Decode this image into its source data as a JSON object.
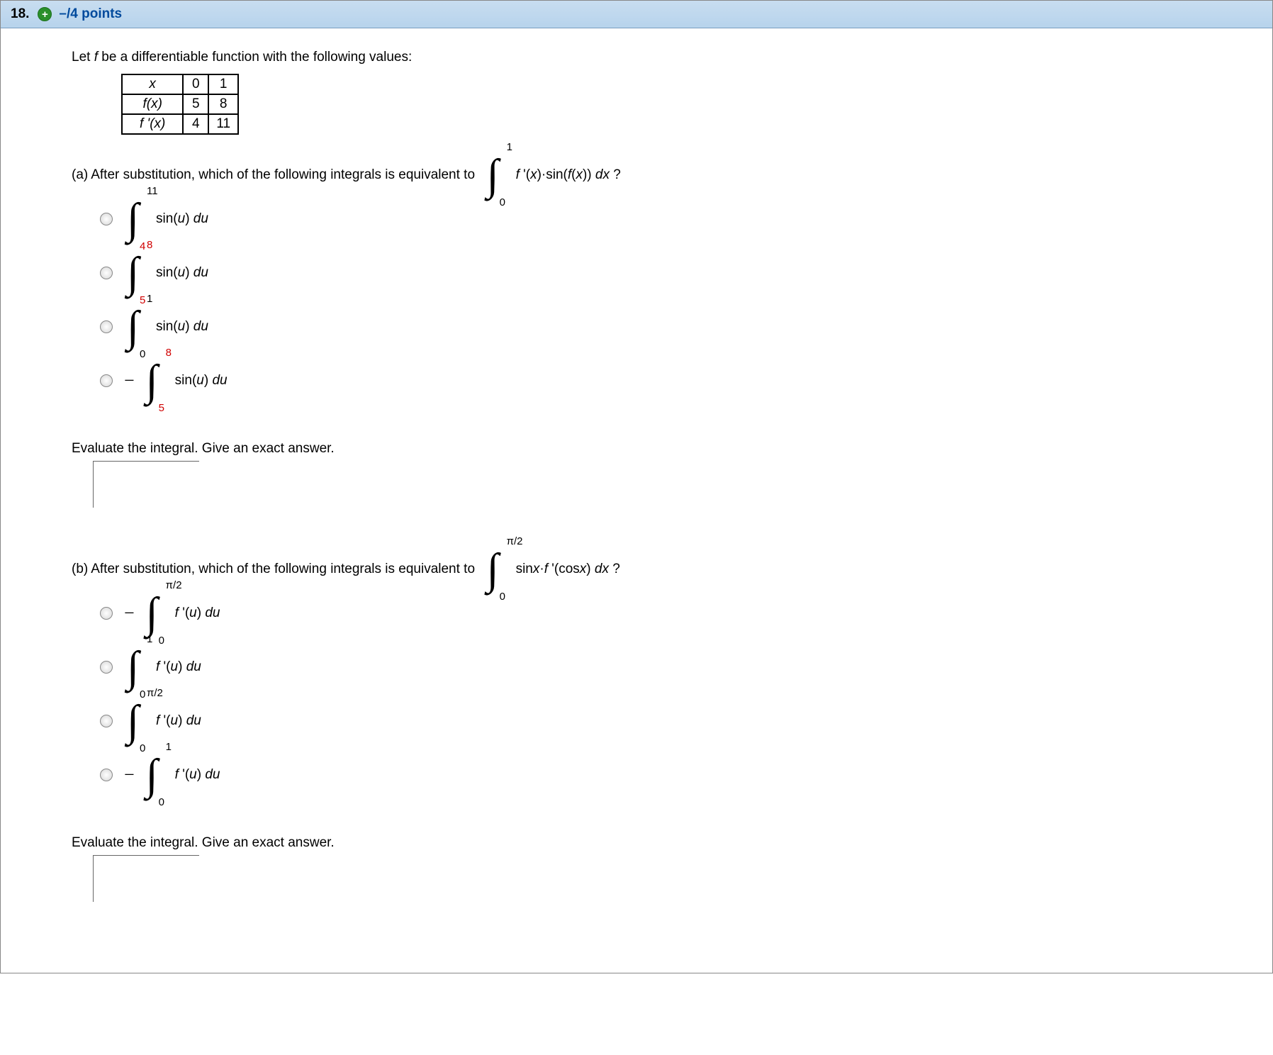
{
  "header": {
    "qnum": "18.",
    "points": "–/4 points"
  },
  "intro": "Let f be a differentiable function with the following values:",
  "table": {
    "rows": [
      {
        "hdr": "x",
        "c0": "0",
        "c1": "1"
      },
      {
        "hdr": "f(x)",
        "c0": "5",
        "c1": "8"
      },
      {
        "hdr": "f '(x)",
        "c0": "4",
        "c1": "11"
      }
    ]
  },
  "partA": {
    "label": "(a)",
    "prompt": "After substitution, which of the following integrals is equivalent to",
    "main_int": {
      "lo": "0",
      "up": "1",
      "integrand": "f '(x)·sin(f(x)) dx",
      "suffix": "?"
    },
    "choices": [
      {
        "neg": false,
        "lo": "4",
        "up": "11",
        "lo_red": true,
        "up_red": false,
        "integrand": "sin(u) du"
      },
      {
        "neg": false,
        "lo": "5",
        "up": "8",
        "lo_red": true,
        "up_red": true,
        "integrand": "sin(u) du"
      },
      {
        "neg": false,
        "lo": "0",
        "up": "1",
        "lo_red": false,
        "up_red": false,
        "integrand": "sin(u) du"
      },
      {
        "neg": true,
        "lo": "5",
        "up": "8",
        "lo_red": true,
        "up_red": true,
        "integrand": "sin(u) du"
      }
    ],
    "eval_prompt": "Evaluate the integral. Give an exact answer."
  },
  "partB": {
    "label": "(b)",
    "prompt": "After substitution, which of the following integrals is equivalent to",
    "main_int": {
      "lo": "0",
      "up": "π/2",
      "integrand": "sinx·f '(cosx) dx",
      "suffix": "?"
    },
    "choices": [
      {
        "neg": true,
        "lo": "0",
        "up": "π/2",
        "lo_red": false,
        "up_red": false,
        "integrand": "f '(u) du"
      },
      {
        "neg": false,
        "lo": "0",
        "up": "1",
        "lo_red": false,
        "up_red": false,
        "integrand": "f '(u) du"
      },
      {
        "neg": false,
        "lo": "0",
        "up": "π/2",
        "lo_red": false,
        "up_red": false,
        "integrand": "f '(u) du"
      },
      {
        "neg": true,
        "lo": "0",
        "up": "1",
        "lo_red": false,
        "up_red": false,
        "integrand": "f '(u) du"
      }
    ],
    "eval_prompt": "Evaluate the integral. Give an exact answer."
  }
}
